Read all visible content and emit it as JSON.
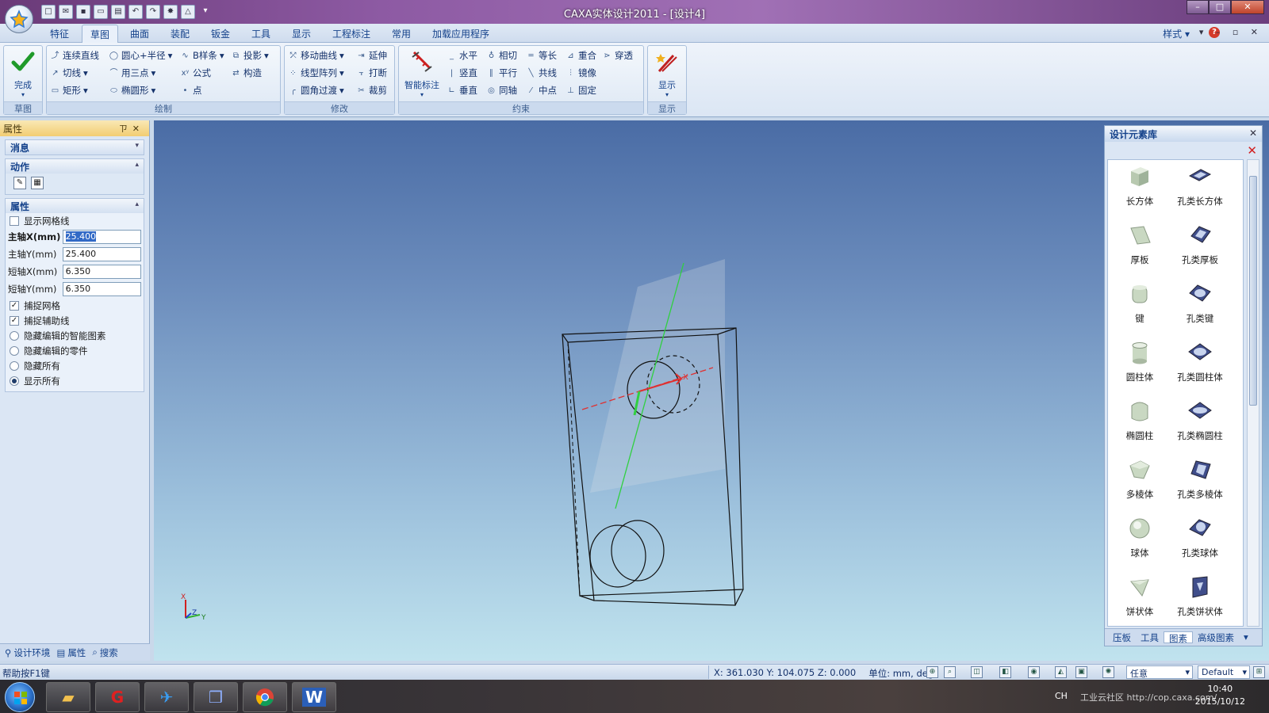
{
  "window": {
    "title": "CAXA实体设计2011 - [设计4]",
    "controls": [
      "–",
      "□",
      "✕"
    ]
  },
  "ribbon_tabs": [
    "特征",
    "草图",
    "曲面",
    "装配",
    "钣金",
    "工具",
    "显示",
    "工程标注",
    "常用",
    "加载应用程序"
  ],
  "active_tab": "草图",
  "ribbon_right": {
    "style_label": "样式",
    "help": "?"
  },
  "ribbon": {
    "groups": {
      "sketch": "草图",
      "draw": "绘制",
      "modify": "修改",
      "constraint": "约束",
      "display": "显示"
    },
    "finish_label": "完成",
    "draw_items": [
      "连续直线",
      "圆心+半径",
      "B样条",
      "投影",
      "切线",
      "用三点",
      "公式",
      "构造",
      "矩形",
      "椭圆形",
      "点"
    ],
    "modify_items": [
      "移动曲线",
      "延伸",
      "线型阵列",
      "打断",
      "圆角过渡",
      "裁剪"
    ],
    "smart_dim_label": "智能标注",
    "constraint_items": [
      "水平",
      "相切",
      "等长",
      "重合",
      "穿透",
      "竖直",
      "平行",
      "共线",
      "镜像",
      "垂直",
      "同轴",
      "中点",
      "固定"
    ],
    "display_label": "显示"
  },
  "left_panel": {
    "title": "属性",
    "sections": {
      "messages": "消息",
      "actions": "动作",
      "properties": "属性"
    },
    "show_grid": {
      "label": "显示网格线",
      "checked": false
    },
    "fields": [
      {
        "label": "主轴X(mm)",
        "value": "25.400"
      },
      {
        "label": "主轴Y(mm)",
        "value": "25.400"
      },
      {
        "label": "短轴X(mm)",
        "value": "6.350"
      },
      {
        "label": "短轴Y(mm)",
        "value": "6.350"
      }
    ],
    "checks": [
      {
        "label": "捕捉网格",
        "checked": true
      },
      {
        "label": "捕捉辅助线",
        "checked": true
      }
    ],
    "radios": [
      {
        "label": "隐藏编辑的智能图素",
        "selected": false
      },
      {
        "label": "隐藏编辑的零件",
        "selected": false
      },
      {
        "label": "隐藏所有",
        "selected": false
      },
      {
        "label": "显示所有",
        "selected": true
      }
    ],
    "bottom_tabs": [
      "设计环境",
      "属性",
      "搜索"
    ]
  },
  "right_panel": {
    "title": "设计元素库",
    "elements": [
      [
        "长方体",
        "孔类长方体"
      ],
      [
        "厚板",
        "孔类厚板"
      ],
      [
        "键",
        "孔类键"
      ],
      [
        "圆柱体",
        "孔类圆柱体"
      ],
      [
        "椭圆柱",
        "孔类椭圆柱"
      ],
      [
        "多棱体",
        "孔类多棱体"
      ],
      [
        "球体",
        "孔类球体"
      ],
      [
        "饼状体",
        "孔类饼状体"
      ]
    ],
    "bottom_tabs": [
      "压板",
      "工具",
      "图素",
      "高级图素"
    ],
    "active_bottom_tab": "图素"
  },
  "viewport": {
    "axis_labels": {
      "x": "X",
      "z": "Z",
      "y": "Y"
    }
  },
  "status_bar": {
    "help_text": "帮助按F1键",
    "coords": "X: 361.030 Y: 104.075 Z: 0.000",
    "units": "单位: mm, deg",
    "snap_mode": "任意",
    "style_mode": "Default"
  },
  "taskbar": {
    "apps": [
      "file-explorer",
      "caxa",
      "browser-ie",
      "app-box",
      "chrome",
      "word"
    ],
    "lang": "CH",
    "watermark": "工业云社区 http://cop.caxa.com/",
    "time": "10:40",
    "date": "2015/10/12"
  },
  "colors": {
    "ribbon_text": "#15428b",
    "viewport_top": "#4a6ca5",
    "viewport_bottom": "#c0e3ee",
    "axis_red": "#e03030",
    "axis_green": "#30d040"
  }
}
